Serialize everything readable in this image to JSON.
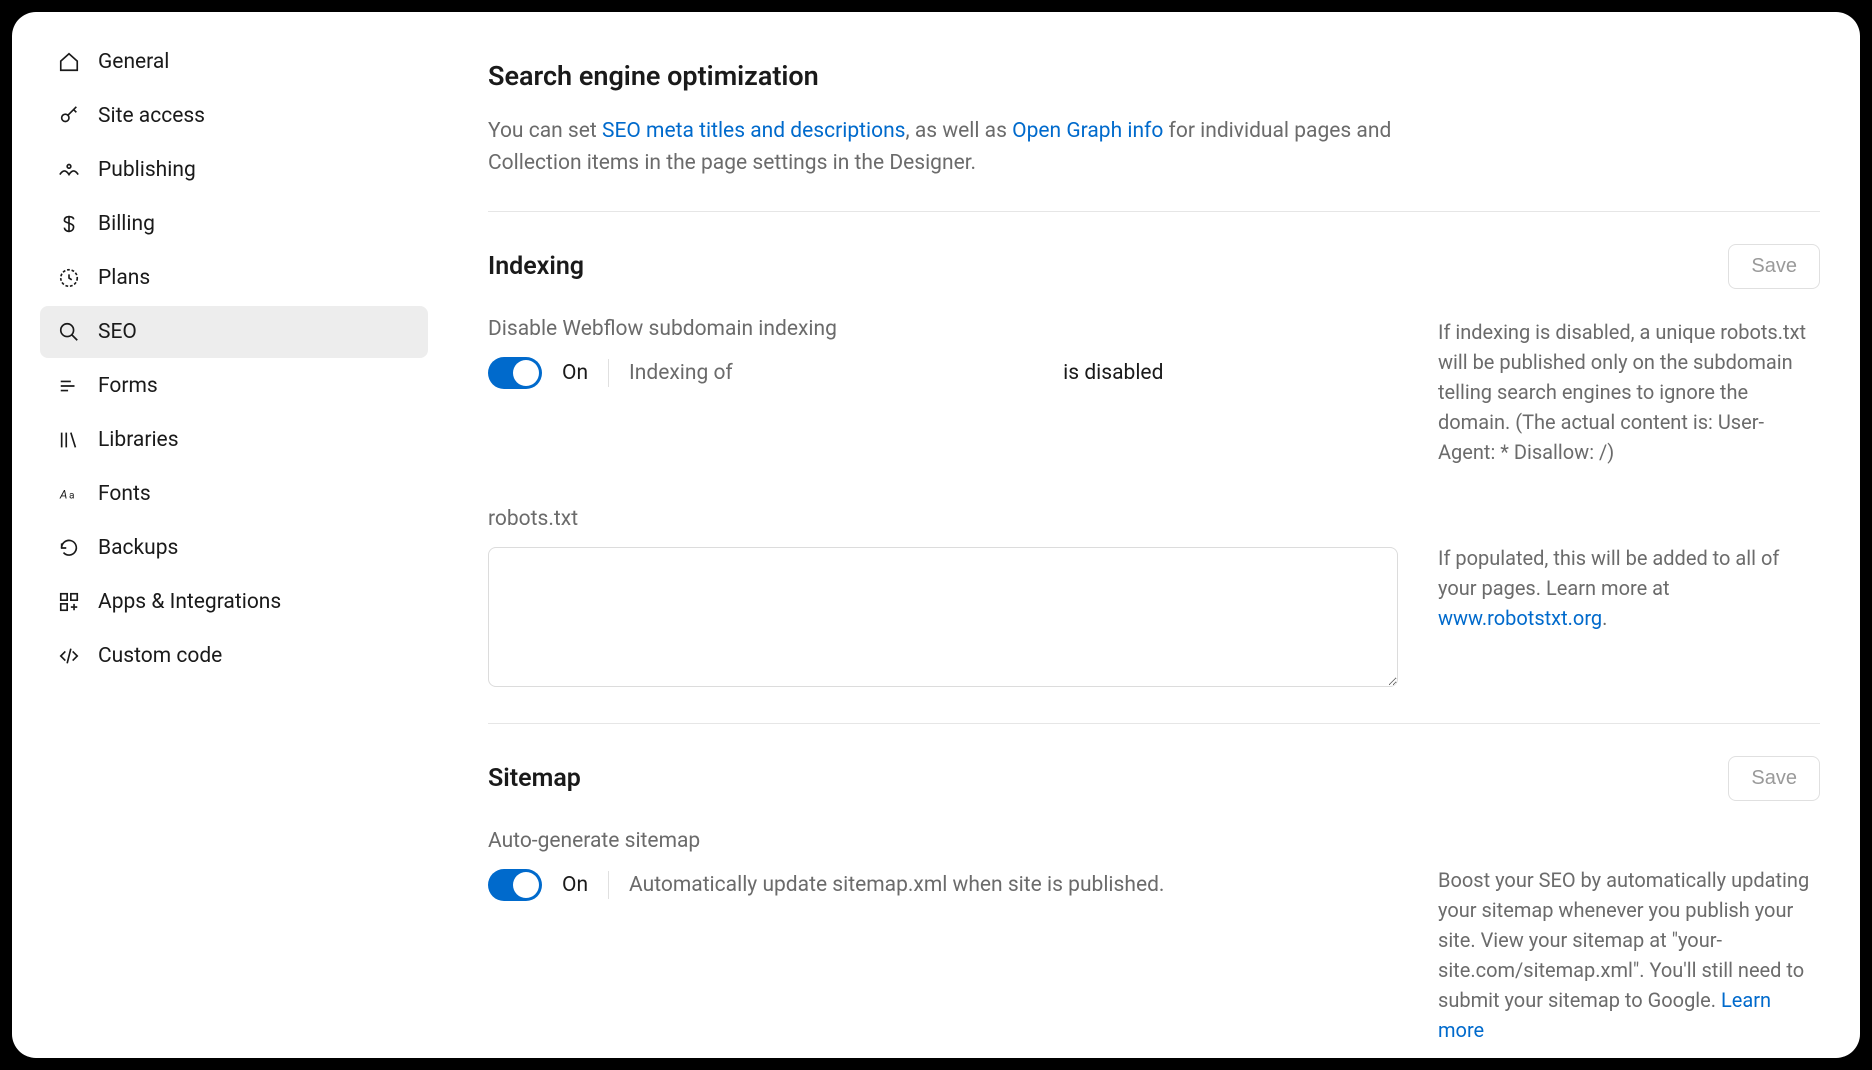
{
  "sidebar": {
    "items": [
      {
        "label": "General"
      },
      {
        "label": "Site access"
      },
      {
        "label": "Publishing"
      },
      {
        "label": "Billing"
      },
      {
        "label": "Plans"
      },
      {
        "label": "SEO"
      },
      {
        "label": "Forms"
      },
      {
        "label": "Libraries"
      },
      {
        "label": "Fonts"
      },
      {
        "label": "Backups"
      },
      {
        "label": "Apps & Integrations"
      },
      {
        "label": "Custom code"
      }
    ]
  },
  "page": {
    "title": "Search engine optimization",
    "intro_pre": "You can set ",
    "intro_link1": "SEO meta titles and descriptions",
    "intro_mid": ", as well as ",
    "intro_link2": "Open Graph info",
    "intro_post": " for individual pages and Collection items in the page settings in the Designer."
  },
  "indexing": {
    "title": "Indexing",
    "save": "Save",
    "disable_label": "Disable Webflow subdomain indexing",
    "toggle_state": "On",
    "desc_pre": "Indexing of ",
    "desc_post": " is disabled",
    "help": "If indexing is disabled, a unique robots.txt will be published only on the subdomain telling search engines to ignore the domain. (The actual content is: User-Agent: * Disallow: /)",
    "robots_label": "robots.txt",
    "robots_value": "",
    "robots_help_pre": "If populated, this will be added to all of your pages. Learn more at ",
    "robots_help_link": "www.robotstxt.org",
    "robots_help_post": "."
  },
  "sitemap": {
    "title": "Sitemap",
    "save": "Save",
    "auto_label": "Auto-generate sitemap",
    "toggle_state": "On",
    "desc": "Automatically update sitemap.xml when site is published.",
    "help_pre": "Boost your SEO by automatically updating your sitemap whenever you publish your site. View your sitemap at \"your-site.com/sitemap.xml\". You'll still need to submit your sitemap to Google. ",
    "help_link": "Learn more"
  }
}
